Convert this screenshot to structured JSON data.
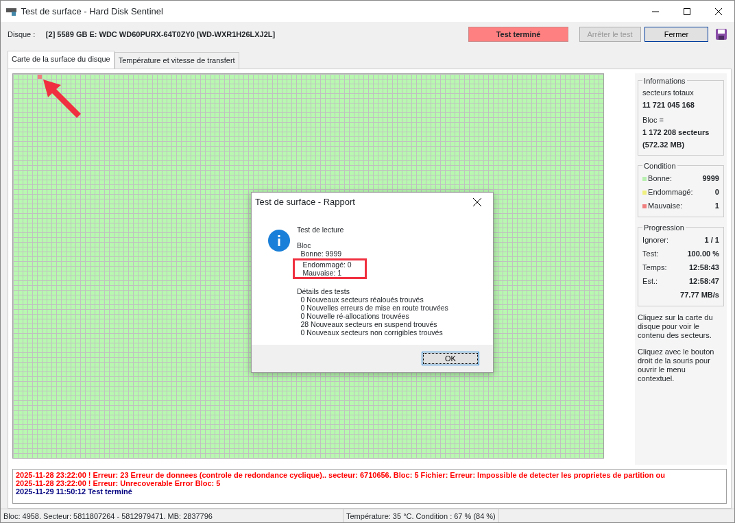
{
  "window": {
    "title": "Test de surface - Hard Disk Sentinel"
  },
  "toolbar": {
    "disk_label": "Disque :",
    "disk_value": "[2] 5589 GB E: WDC WD60PURX-64T0ZY0 [WD-WXR1H26LXJ2L]",
    "status": "Test terminé",
    "buttons": [
      {
        "label": "Arrêter le test",
        "disabled": true
      },
      {
        "label": "Fermer",
        "disabled": false
      }
    ]
  },
  "tabs": [
    {
      "label": "Carte de la surface du disque",
      "selected": true
    },
    {
      "label": "Température et vitesse de transfert",
      "selected": false
    }
  ],
  "info": {
    "title": "Informations",
    "lines": [
      "secteurs totaux",
      "11 721 045 168",
      "Bloc =",
      "1 172 208 secteurs",
      "(572.32 MB)"
    ]
  },
  "condition": {
    "title": "Condition",
    "rows": [
      {
        "label": "Bonne:",
        "value": "9999",
        "color": "#b8f0b0"
      },
      {
        "label": "Endommagé:",
        "value": "0",
        "color": "#f0f080"
      },
      {
        "label": "Mauvaise:",
        "value": "1",
        "color": "#f08080"
      }
    ]
  },
  "progression": {
    "title": "Progression",
    "rows": [
      {
        "label": "Ignorer:",
        "value": "1 / 1"
      },
      {
        "label": "Test:",
        "value": "100.00 %"
      },
      {
        "label": "Temps:",
        "value": "12:58:43"
      },
      {
        "label": "Est.:",
        "value": "12:58:47"
      },
      {
        "label": "",
        "value": "77.77 MB/s"
      }
    ]
  },
  "hints": [
    "Cliquez sur la carte du disque pour voir le contenu des secteurs.",
    "Cliquez avec le bouton droit de la souris pour ouvrir le menu contextuel."
  ],
  "log": [
    {
      "kind": "error",
      "text": "2025-11-28  23:22:00 ! Erreur: 23 Erreur de donnees (controle de redondance cyclique).. secteur: 6710656. Bloc: 5  Fichier: Erreur: Impossible de detecter les proprietes de partition ou"
    },
    {
      "kind": "error",
      "text": "2025-11-28  23:22:00 ! Erreur: Unrecoverable Error Bloc: 5"
    },
    {
      "kind": "info",
      "text": "2025-11-29  11:50:12   Test terminé"
    }
  ],
  "status_bar": [
    "Bloc: 4958. Secteur: 5811807264 - 5812979471. MB: 2837796",
    "Température: 35  °C.  Condition : 67 % (84 %)"
  ],
  "dialog": {
    "title": "Test de surface - Rapport",
    "heading": "Test de lecture",
    "section1": "Bloc",
    "items1": [
      "Bonne: 9999",
      "Endommagé: 0",
      "Mauvaise: 1"
    ],
    "section2": "Détails des tests",
    "items2": [
      "0 Nouveaux secteurs réaloués trouvés",
      "0 Nouvelles erreurs de mise en route trouvées",
      "0 Nouvelle ré-allocations trouvées",
      "28 Nouveaux secteurs en suspend trouvés",
      "0 Nouveaux secteurs non corrigibles trouvés"
    ],
    "ok": "OK"
  }
}
